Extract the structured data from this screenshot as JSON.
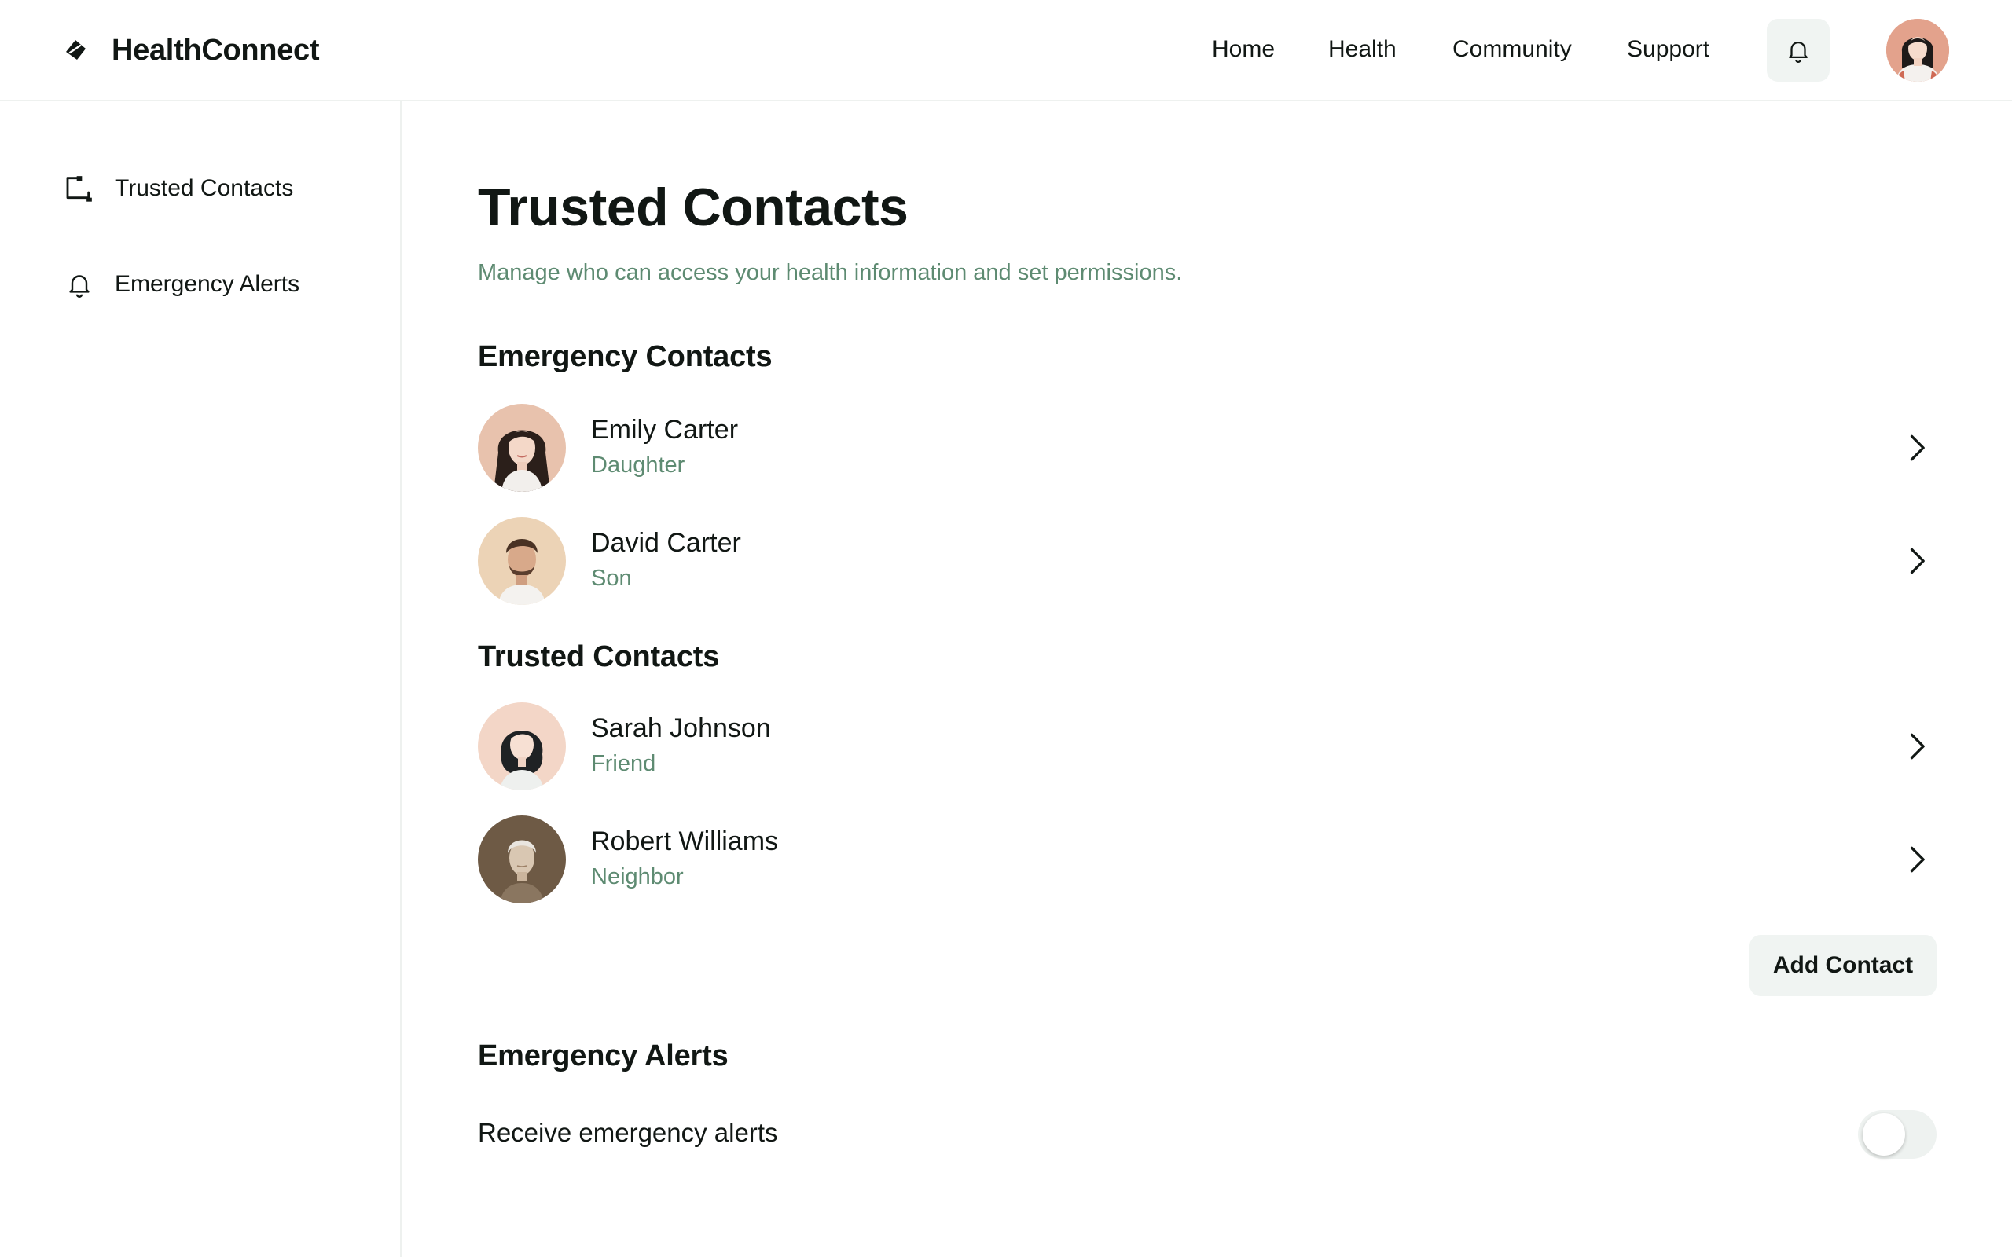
{
  "app": {
    "brand_name": "HealthConnect",
    "logo_icon": "leaf-diamond-icon"
  },
  "header": {
    "nav": [
      {
        "label": "Home"
      },
      {
        "label": "Health"
      },
      {
        "label": "Community"
      },
      {
        "label": "Support"
      }
    ],
    "notifications_icon": "bell-icon",
    "user_avatar": "user-avatar-woman"
  },
  "sidebar": {
    "items": [
      {
        "label": "Trusted Contacts",
        "icon": "contacts-card-icon"
      },
      {
        "label": "Emergency Alerts",
        "icon": "bell-icon"
      }
    ]
  },
  "main": {
    "title": "Trusted Contacts",
    "subtitle": "Manage who can access your health information and set permissions.",
    "emergency_section": {
      "heading": "Emergency Contacts",
      "contacts": [
        {
          "name": "Emily Carter",
          "relation": "Daughter"
        },
        {
          "name": "David Carter",
          "relation": "Son"
        }
      ]
    },
    "trusted_section": {
      "heading": "Trusted Contacts",
      "contacts": [
        {
          "name": "Sarah Johnson",
          "relation": "Friend"
        },
        {
          "name": "Robert Williams",
          "relation": "Neighbor"
        }
      ]
    },
    "add_contact_label": "Add Contact",
    "alerts_section": {
      "heading": "Emergency Alerts",
      "toggle_label": "Receive emergency alerts",
      "toggle_on": false
    }
  },
  "colors": {
    "accent_green_text": "#5e8b72",
    "button_bg": "#f0f4f2",
    "text": "#111714"
  }
}
